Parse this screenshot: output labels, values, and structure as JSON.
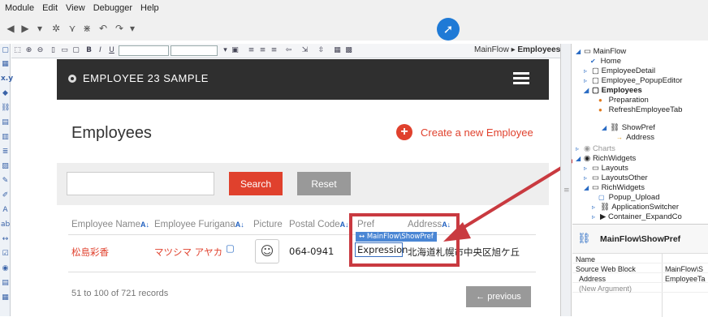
{
  "menubar": {
    "items": [
      "Module",
      "Edit",
      "View",
      "Debugger",
      "Help"
    ]
  },
  "editor": {
    "breadcrumb_parent": "MainFlow",
    "breadcrumb_sep": "▸",
    "breadcrumb_current": "Employees"
  },
  "app": {
    "header_title": "EMPLOYEE 23 SAMPLE",
    "page_title": "Employees",
    "create_label": "Create a new Employee",
    "search_label": "Search",
    "reset_label": "Reset",
    "columns": [
      "Employee Name",
      "Employee Furigana",
      "Picture",
      "Postal Code",
      "Pref",
      "Address"
    ],
    "row": {
      "name": "松島彩香",
      "furigana": "マツシマ アヤカ",
      "postal": "064-0941",
      "address": "北海道札幌市中央区旭ケ丘"
    },
    "records_text": "51 to 100 of 721 records",
    "previous_label": "← previous",
    "wblock_tag": "↔ MainFlow\\ShowPref",
    "expression_text": "Expression"
  },
  "tree": [
    {
      "label": "MainFlow",
      "icon": "flow-icon"
    },
    {
      "label": "Home",
      "icon": "home-icon"
    },
    {
      "label": "EmployeeDetail",
      "icon": "screen-icon"
    },
    {
      "label": "Employee_PopupEditor",
      "icon": "screen-icon"
    },
    {
      "label": "Employees",
      "icon": "screen-icon"
    },
    {
      "label": "Preparation",
      "icon": "preparation-icon"
    },
    {
      "label": "RefreshEmployeeTab",
      "icon": "action-icon"
    },
    {
      "label": "ShowPref",
      "icon": "webblock-icon"
    },
    {
      "label": "Address",
      "icon": "input-param-icon"
    },
    {
      "label": "Charts",
      "icon": "module-icon"
    },
    {
      "label": "RichWidgets",
      "icon": "module-icon"
    },
    {
      "label": "Layouts",
      "icon": "flow-icon"
    },
    {
      "label": "LayoutsOther",
      "icon": "flow-icon"
    },
    {
      "label": "RichWidgets",
      "icon": "flow-icon"
    },
    {
      "label": "Popup_Upload",
      "icon": "screen-icon"
    },
    {
      "label": "ApplicationSwitcher",
      "icon": "webblock-icon"
    },
    {
      "label": "Container_ExpandCo",
      "icon": "webblock-icon"
    }
  ],
  "properties": {
    "title": "MainFlow\\ShowPref",
    "rows": [
      {
        "key": "Name",
        "value": ""
      },
      {
        "key": "Source Web Block",
        "value": "MainFlow\\S"
      },
      {
        "key": "Address",
        "value": "EmployeeTa"
      },
      {
        "key": "(New Argument)",
        "value": ""
      }
    ]
  },
  "colors": {
    "accent": "#e0412d",
    "header": "#2f2f2f",
    "highlight": "#c93a40",
    "link_blue": "#2b6cc4"
  }
}
